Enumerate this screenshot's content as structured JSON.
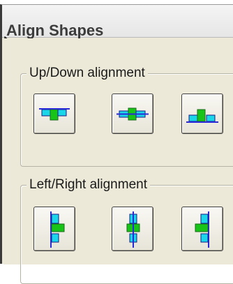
{
  "window": {
    "title": "Align Shapes"
  },
  "updown": {
    "legend": "Up/Down alignment",
    "buttons": [
      {
        "name": "align-top-button",
        "icon": "align-top-icon"
      },
      {
        "name": "align-middle-button",
        "icon": "align-middle-icon"
      },
      {
        "name": "align-bottom-button",
        "icon": "align-bottom-icon"
      }
    ]
  },
  "leftright": {
    "legend": "Left/Right alignment",
    "buttons": [
      {
        "name": "align-left-button",
        "icon": "align-left-icon"
      },
      {
        "name": "align-center-button",
        "icon": "align-center-icon"
      },
      {
        "name": "align-right-button",
        "icon": "align-right-icon"
      }
    ]
  },
  "colors": {
    "cyan": "#19d6e8",
    "green": "#19c419",
    "line": "#2a2ad8"
  }
}
